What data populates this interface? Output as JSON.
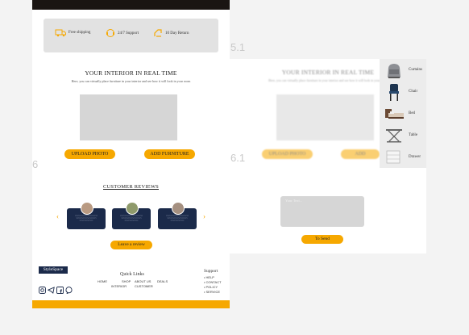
{
  "left_page": {
    "features": [
      {
        "icon": "truck-icon",
        "label": "Free shipping"
      },
      {
        "icon": "support-icon",
        "label": "24/7 Support"
      },
      {
        "icon": "return-icon",
        "label": "10 Day Return"
      }
    ],
    "realtime": {
      "title": "YOUR INTERIOR IN REAL TIME",
      "subtitle": "Here, you can virtually place furniture in your interior and see how it will look in your room",
      "upload_label": "UPLOAD PHOTO",
      "add_label": "ADD FURNITURE"
    },
    "reviews": {
      "title": "CUSTOMER REVIEWS",
      "prev": "‹",
      "next": "›",
      "leave_label": "Leave a review"
    },
    "footer": {
      "logo": "StyleSpace",
      "quick_links_title": "Quick Links",
      "links_row1": [
        "HOME",
        "SHOP",
        "ABOUT US",
        "DEALS"
      ],
      "links_row2": [
        "INTERIOR",
        "CUSTOMER"
      ],
      "support_title": "Support",
      "support_items": [
        "• HELP",
        "• CONTACT",
        "• POLICY",
        "• SERVICE"
      ],
      "socials": [
        "instagram-icon",
        "telegram-icon",
        "facebook-icon",
        "viber-icon"
      ]
    }
  },
  "section_numbers": {
    "right_top": "5.1",
    "left_mid": "6",
    "right_mid": "6.1"
  },
  "right_page": {
    "title": "YOUR INTERIOR IN REAL TIME",
    "subtitle": "Here, you can virtually place furniture in your interior and see how it will look in your room",
    "upload_label": "UPLOAD PHOTO",
    "add_label": "ADD FURNITURE",
    "dropdown": [
      "Curtains",
      "Chair",
      "Bed",
      "Table",
      "Drawer"
    ],
    "review_placeholder": "Your Text...",
    "send_label": "To Send"
  },
  "colors": {
    "accent": "#f6a800",
    "navy": "#1b2a4a"
  }
}
